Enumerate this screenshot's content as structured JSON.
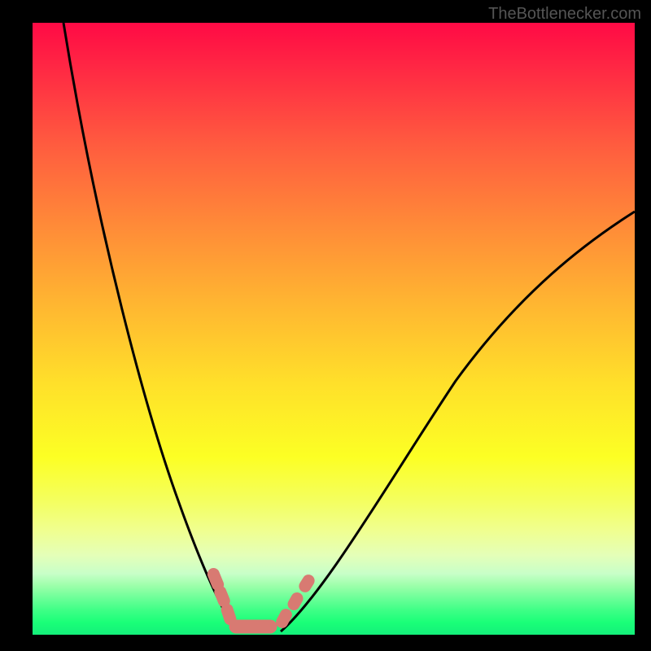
{
  "watermark": "TheBottlenecker.com",
  "chart_data": {
    "type": "line",
    "title": "",
    "xlabel": "",
    "ylabel": "",
    "x_range": [
      0,
      100
    ],
    "y_range": [
      0,
      100
    ],
    "series": [
      {
        "name": "left-curve",
        "values_approx": "Steep decreasing curve from y≈100 at x≈5 down to y≈0 at x≈34; convex (decelerating)."
      },
      {
        "name": "right-curve",
        "values_approx": "Increasing curve from y≈0 at x≈42 rising to y≈68 at x≈100; concave (decelerating slope)."
      },
      {
        "name": "markers",
        "note": "Coral pill-shaped markers near minimum region where both curves approach y≈0, roughly x≈30–44."
      }
    ],
    "gradient_bands_meaning": "Background color indicates bottleneck severity (red=high, green=optimal)"
  },
  "colors": {
    "curve": "#000000",
    "marker": "#d87a72",
    "watermark": "#555555"
  }
}
